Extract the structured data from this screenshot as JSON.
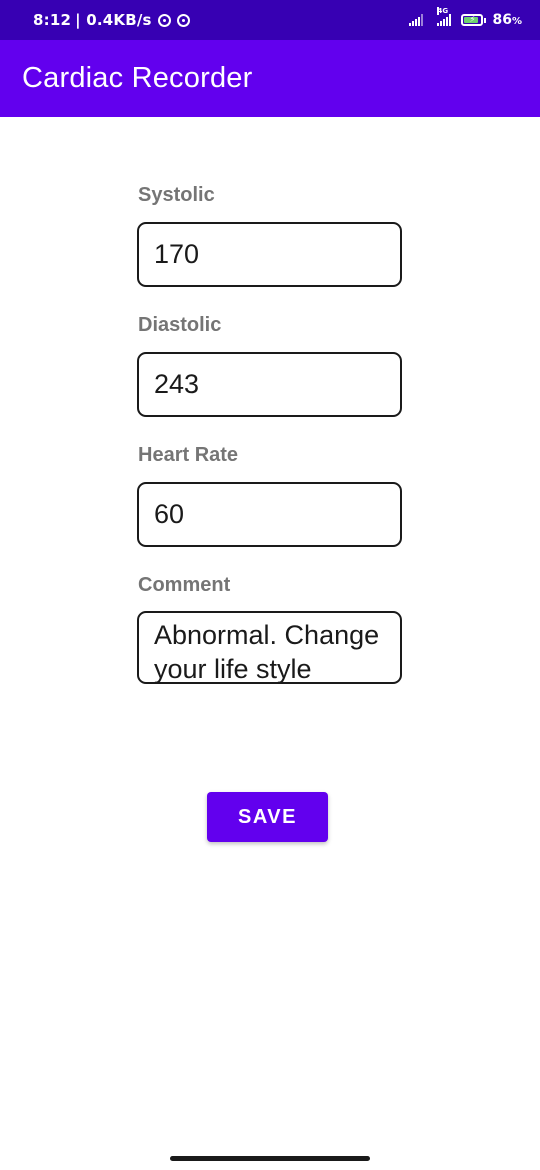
{
  "status_bar": {
    "time": "8:12",
    "network_speed": "| 0.4KB/s",
    "network_type": "4G",
    "battery_percent": "86",
    "battery_symbol": "%",
    "battery_fill_fraction": 0.86,
    "icons": [
      "notification-ring-icon",
      "notification-ring-icon",
      "signal-icon",
      "signal-4g-icon",
      "battery-charging-icon"
    ]
  },
  "app_bar": {
    "title": "Cardiac Recorder",
    "color": "#6200ee",
    "status_color": "#3700b3"
  },
  "form": {
    "systolic": {
      "label": "Systolic",
      "value": "170"
    },
    "diastolic": {
      "label": "Diastolic",
      "value": "243"
    },
    "heart_rate": {
      "label": "Heart Rate",
      "value": "60"
    },
    "comment": {
      "label": "Comment",
      "value": "Abnormal. Change your life style"
    }
  },
  "actions": {
    "save_label": "SAVE"
  }
}
